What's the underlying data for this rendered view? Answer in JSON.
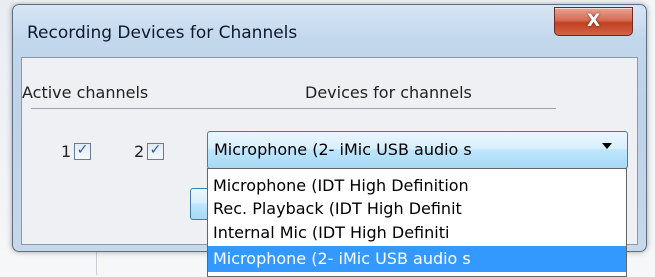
{
  "window": {
    "title": "Recording Devices for Channels",
    "close_icon": "close-icon",
    "close_glyph": "X"
  },
  "headers": {
    "active_channels": "Active channels",
    "devices_for_channels": "Devices for channels"
  },
  "channels": [
    {
      "number": "1",
      "checked": true
    },
    {
      "number": "2",
      "checked": true
    }
  ],
  "check_glyph": "✓",
  "device_select": {
    "value": "Microphone (2- iMic USB audio s",
    "options": [
      "Microphone (IDT High Definition",
      "Rec. Playback (IDT High Definit",
      "Internal Mic (IDT High Definiti",
      "Microphone (2- iMic USB audio s"
    ],
    "selected_index": 3
  },
  "colors": {
    "selection": "#3399ff",
    "close_button": "#c2401f",
    "check": "#2b56b8"
  }
}
